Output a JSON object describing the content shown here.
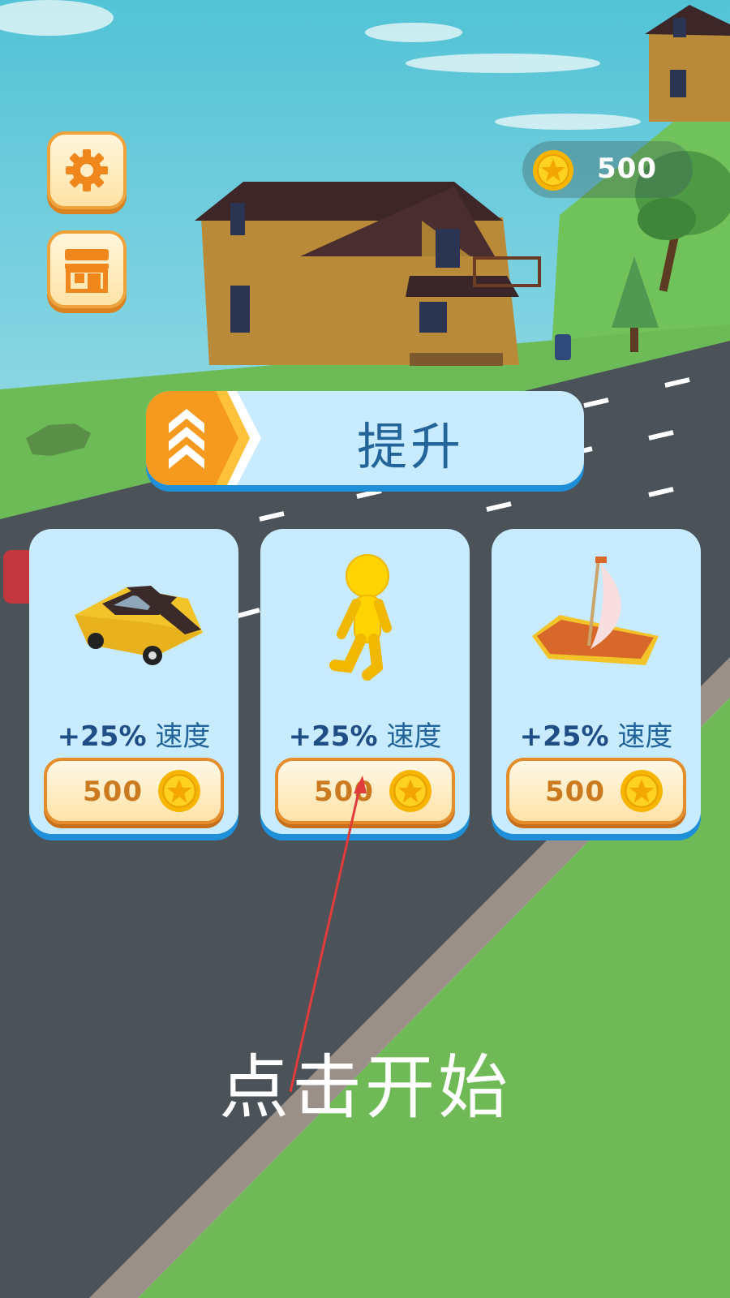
{
  "hud": {
    "settings_icon": "gear-icon",
    "shop_icon": "shop-icon",
    "coin_amount": "500"
  },
  "upgrade": {
    "title": "提升",
    "badge_icon": "chevrons-up-icon"
  },
  "cards": [
    {
      "item": "car",
      "boost_value": "+25%",
      "boost_label": "速度",
      "price": "500"
    },
    {
      "item": "runner",
      "boost_value": "+25%",
      "boost_label": "速度",
      "price": "500"
    },
    {
      "item": "boat",
      "boost_value": "+25%",
      "boost_label": "速度",
      "price": "500"
    }
  ],
  "start_prompt": "点击开始",
  "colors": {
    "panel": "#c8ebff",
    "panel_shadow": "#1e8fd8",
    "accent_orange": "#f59a1e",
    "text_blue": "#23659a",
    "grass": "#6dbb57",
    "road": "#4b5258"
  }
}
